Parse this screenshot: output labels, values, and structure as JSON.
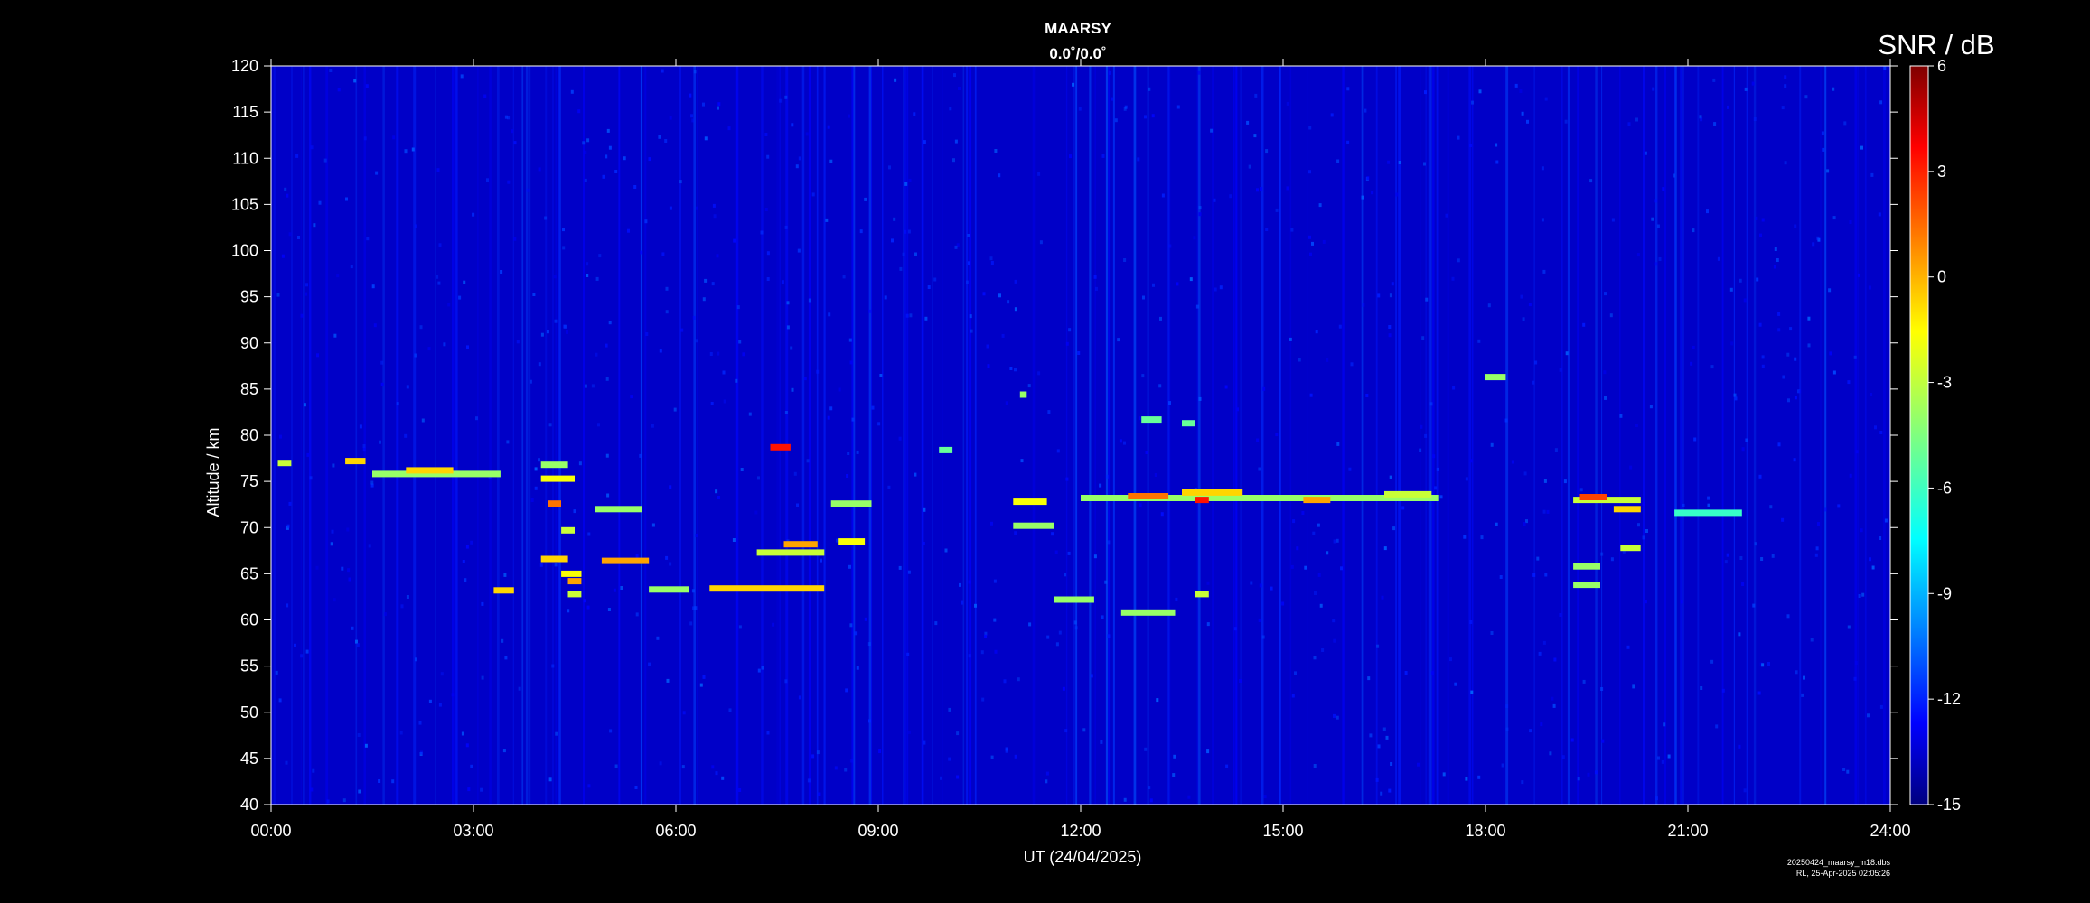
{
  "chart_data": {
    "type": "heatmap",
    "title": "MAARSY",
    "subtitle": "0.0˚/0.0˚",
    "xlabel": "UT (24/04/2025)",
    "ylabel": "Altitude / km",
    "colorbar_label": "SNR / dB",
    "xlim": [
      0,
      24
    ],
    "ylim": [
      40,
      120
    ],
    "clim": [
      -15,
      6
    ],
    "x_ticks": [
      {
        "value": 0,
        "label": "00:00"
      },
      {
        "value": 3,
        "label": "03:00"
      },
      {
        "value": 6,
        "label": "06:00"
      },
      {
        "value": 9,
        "label": "09:00"
      },
      {
        "value": 12,
        "label": "12:00"
      },
      {
        "value": 15,
        "label": "15:00"
      },
      {
        "value": 18,
        "label": "18:00"
      },
      {
        "value": 21,
        "label": "21:00"
      },
      {
        "value": 24,
        "label": "24:00"
      }
    ],
    "y_ticks": [
      {
        "value": 40,
        "label": "40"
      },
      {
        "value": 45,
        "label": "45"
      },
      {
        "value": 50,
        "label": "50"
      },
      {
        "value": 55,
        "label": "55"
      },
      {
        "value": 60,
        "label": "60"
      },
      {
        "value": 65,
        "label": "65"
      },
      {
        "value": 70,
        "label": "70"
      },
      {
        "value": 75,
        "label": "75"
      },
      {
        "value": 80,
        "label": "80"
      },
      {
        "value": 85,
        "label": "85"
      },
      {
        "value": 90,
        "label": "90"
      },
      {
        "value": 95,
        "label": "95"
      },
      {
        "value": 100,
        "label": "100"
      },
      {
        "value": 105,
        "label": "105"
      },
      {
        "value": 110,
        "label": "110"
      },
      {
        "value": 115,
        "label": "115"
      },
      {
        "value": 120,
        "label": "120"
      }
    ],
    "colorbar_ticks": [
      {
        "value": 6,
        "label": "6"
      },
      {
        "value": 3,
        "label": "3"
      },
      {
        "value": 0,
        "label": "0"
      },
      {
        "value": -3,
        "label": "-3"
      },
      {
        "value": -6,
        "label": "-6"
      },
      {
        "value": -9,
        "label": "-9"
      },
      {
        "value": -12,
        "label": "-12"
      },
      {
        "value": -15,
        "label": "-15"
      }
    ],
    "background_snr": -13.5,
    "echo_features": [
      {
        "t0": 0.1,
        "t1": 0.3,
        "alt": 77.0,
        "snr": -3
      },
      {
        "t0": 1.1,
        "t1": 1.4,
        "alt": 77.2,
        "snr": -1
      },
      {
        "t0": 1.5,
        "t1": 3.4,
        "alt": 75.8,
        "snr": -4
      },
      {
        "t0": 2.0,
        "t1": 2.7,
        "alt": 76.2,
        "snr": -1
      },
      {
        "t0": 3.3,
        "t1": 3.6,
        "alt": 63.2,
        "snr": -1
      },
      {
        "t0": 4.0,
        "t1": 4.4,
        "alt": 76.8,
        "snr": -4
      },
      {
        "t0": 4.0,
        "t1": 4.5,
        "alt": 75.3,
        "snr": -2
      },
      {
        "t0": 4.1,
        "t1": 4.3,
        "alt": 72.6,
        "snr": 1
      },
      {
        "t0": 4.3,
        "t1": 4.5,
        "alt": 69.7,
        "snr": -3
      },
      {
        "t0": 4.0,
        "t1": 4.4,
        "alt": 66.6,
        "snr": -1
      },
      {
        "t0": 4.3,
        "t1": 4.6,
        "alt": 65.0,
        "snr": -2
      },
      {
        "t0": 4.4,
        "t1": 4.6,
        "alt": 64.2,
        "snr": 0
      },
      {
        "t0": 4.4,
        "t1": 4.6,
        "alt": 62.8,
        "snr": -3
      },
      {
        "t0": 4.8,
        "t1": 5.5,
        "alt": 72.0,
        "snr": -4
      },
      {
        "t0": 4.9,
        "t1": 5.6,
        "alt": 66.4,
        "snr": 0
      },
      {
        "t0": 5.6,
        "t1": 6.2,
        "alt": 63.3,
        "snr": -4
      },
      {
        "t0": 6.5,
        "t1": 8.2,
        "alt": 63.4,
        "snr": -1
      },
      {
        "t0": 7.4,
        "t1": 7.7,
        "alt": 78.7,
        "snr": 3
      },
      {
        "t0": 7.2,
        "t1": 8.2,
        "alt": 67.3,
        "snr": -3
      },
      {
        "t0": 7.6,
        "t1": 8.1,
        "alt": 68.2,
        "snr": 0
      },
      {
        "t0": 8.3,
        "t1": 8.9,
        "alt": 72.6,
        "snr": -4
      },
      {
        "t0": 8.4,
        "t1": 8.8,
        "alt": 68.5,
        "snr": -2
      },
      {
        "t0": 9.9,
        "t1": 10.1,
        "alt": 78.4,
        "snr": -5
      },
      {
        "t0": 11.1,
        "t1": 11.2,
        "alt": 84.4,
        "snr": -4
      },
      {
        "t0": 11.0,
        "t1": 11.5,
        "alt": 72.8,
        "snr": -2
      },
      {
        "t0": 11.0,
        "t1": 11.6,
        "alt": 70.2,
        "snr": -4
      },
      {
        "t0": 11.6,
        "t1": 12.2,
        "alt": 62.2,
        "snr": -4
      },
      {
        "t0": 12.0,
        "t1": 17.3,
        "alt": 73.2,
        "snr": -4
      },
      {
        "t0": 12.7,
        "t1": 13.3,
        "alt": 73.4,
        "snr": 1
      },
      {
        "t0": 13.5,
        "t1": 14.4,
        "alt": 73.8,
        "snr": -1
      },
      {
        "t0": 13.7,
        "t1": 13.9,
        "alt": 73.0,
        "snr": 3
      },
      {
        "t0": 12.9,
        "t1": 13.2,
        "alt": 81.7,
        "snr": -5
      },
      {
        "t0": 13.5,
        "t1": 13.7,
        "alt": 81.3,
        "snr": -5
      },
      {
        "t0": 12.6,
        "t1": 13.4,
        "alt": 60.8,
        "snr": -4
      },
      {
        "t0": 13.7,
        "t1": 13.9,
        "alt": 62.8,
        "snr": -3
      },
      {
        "t0": 15.3,
        "t1": 15.7,
        "alt": 73.0,
        "snr": 0
      },
      {
        "t0": 16.5,
        "t1": 17.2,
        "alt": 73.6,
        "snr": -3
      },
      {
        "t0": 18.0,
        "t1": 18.3,
        "alt": 86.3,
        "snr": -4
      },
      {
        "t0": 19.3,
        "t1": 20.3,
        "alt": 73.0,
        "snr": -3
      },
      {
        "t0": 19.4,
        "t1": 19.8,
        "alt": 73.3,
        "snr": 2
      },
      {
        "t0": 19.9,
        "t1": 20.3,
        "alt": 72.0,
        "snr": -1
      },
      {
        "t0": 19.3,
        "t1": 19.7,
        "alt": 65.8,
        "snr": -4
      },
      {
        "t0": 19.3,
        "t1": 19.7,
        "alt": 63.8,
        "snr": -4
      },
      {
        "t0": 20.0,
        "t1": 20.3,
        "alt": 67.8,
        "snr": -3
      },
      {
        "t0": 20.8,
        "t1": 21.8,
        "alt": 71.6,
        "snr": -6
      }
    ]
  },
  "footer": {
    "line1": "20250424_maarsy_m18.dbs",
    "line2": "RL, 25-Apr-2025 02:05:26"
  }
}
